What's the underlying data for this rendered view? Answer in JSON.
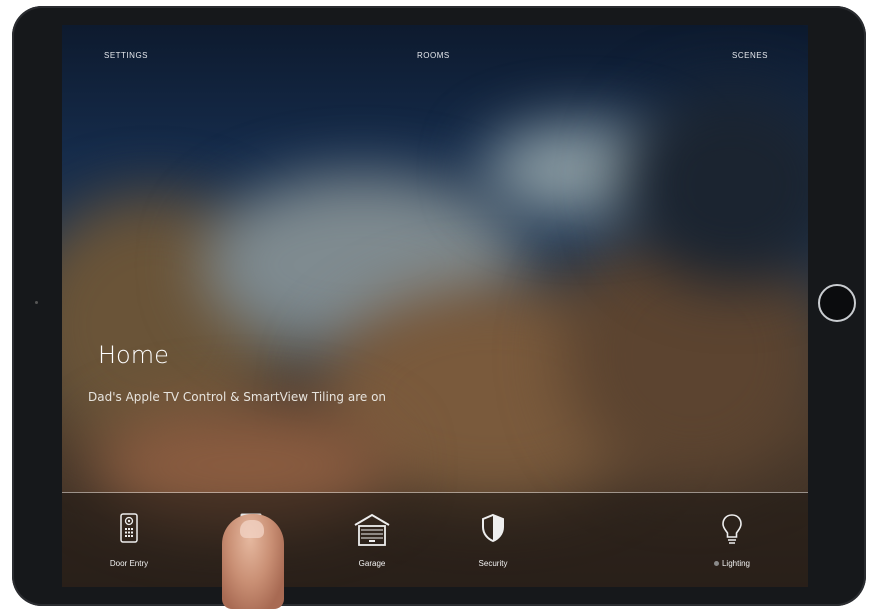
{
  "nav": {
    "settings": "SETTINGS",
    "rooms": "ROOMS",
    "scenes": "SCENES"
  },
  "home": {
    "title": "Home",
    "status": "Dad's Apple TV Control & SmartView Tiling are on"
  },
  "tabs": [
    {
      "label": "Door Entry",
      "icon": "intercom-icon"
    },
    {
      "label": "",
      "icon": "display-icon"
    },
    {
      "label": "Garage",
      "icon": "garage-icon"
    },
    {
      "label": "Security",
      "icon": "shield-icon"
    },
    {
      "label": "Lighting",
      "icon": "lightbulb-icon",
      "indicator": "status-dot"
    }
  ],
  "colors": {
    "text": "#ffffff",
    "sky": "#152b4a",
    "ground": "#4a3a2c"
  }
}
